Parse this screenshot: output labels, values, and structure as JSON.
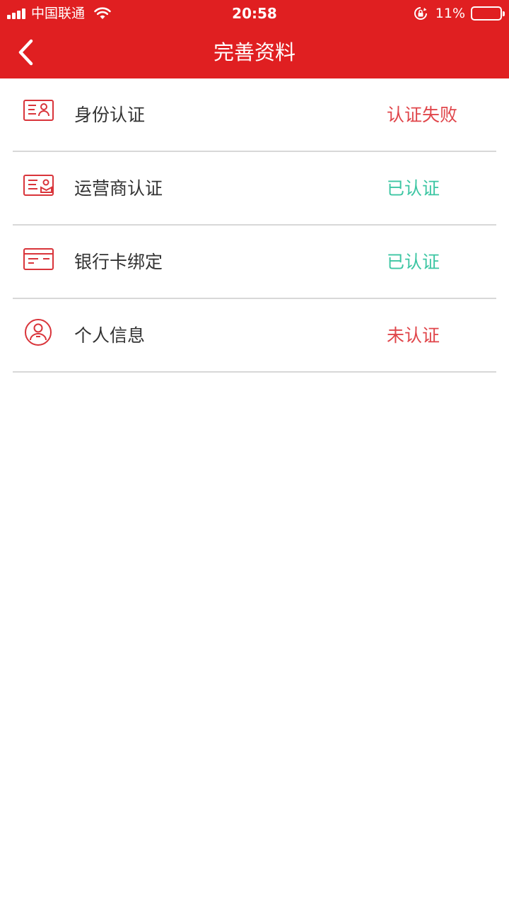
{
  "status_bar": {
    "carrier": "中国联通",
    "time": "20:58",
    "battery": "11%",
    "battery_level": 0.11
  },
  "nav": {
    "title": "完善资料",
    "back_icon": "chevron-left-icon"
  },
  "colors": {
    "brand": "#e01f21",
    "status_fail": "#e0464b",
    "status_ok": "#3dc6a3",
    "text": "#333333",
    "divider": "#d8d8d8"
  },
  "items": [
    {
      "label": "身份认证",
      "status": "认证失败",
      "state": "fail",
      "icon": "id-card-icon"
    },
    {
      "label": "运营商认证",
      "status": "已认证",
      "state": "ok",
      "icon": "carrier-card-icon"
    },
    {
      "label": "银行卡绑定",
      "status": "已认证",
      "state": "ok",
      "icon": "bank-card-icon"
    },
    {
      "label": "个人信息",
      "status": "未认证",
      "state": "fail",
      "icon": "user-circle-icon"
    }
  ]
}
